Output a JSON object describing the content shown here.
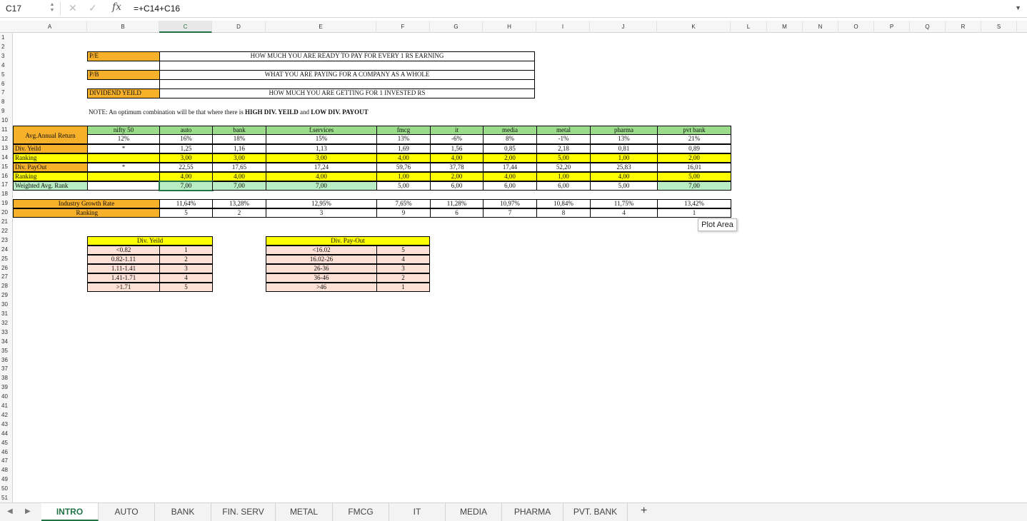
{
  "formula_bar": {
    "cell_ref": "C17",
    "formula": "=+C14+C16"
  },
  "columns": [
    "A",
    "B",
    "C",
    "D",
    "E",
    "F",
    "G",
    "H",
    "I",
    "J",
    "K",
    "L",
    "M",
    "N",
    "O",
    "P",
    "Q",
    "R",
    "S"
  ],
  "rows": [
    "1",
    "2",
    "3",
    "4",
    "5",
    "6",
    "7",
    "8",
    "9",
    "10",
    "11",
    "12",
    "13",
    "14",
    "15",
    "16",
    "17",
    "18",
    "19",
    "20",
    "21",
    "22",
    "23",
    "24",
    "25",
    "26",
    "27",
    "28",
    "29",
    "30",
    "31",
    "32",
    "33",
    "34",
    "35",
    "36",
    "37",
    "38",
    "39",
    "40",
    "41",
    "42",
    "43",
    "44",
    "45",
    "46",
    "47",
    "48",
    "49",
    "50",
    "51"
  ],
  "definitions": [
    {
      "term": "P/E",
      "meaning": "HOW MUCH YOU ARE READY TO PAY FOR EVERY 1 RS EARNING"
    },
    {
      "term": "P/B",
      "meaning": "WHAT YOU ARE PAYING FOR A COMPANY AS A WHOLE"
    },
    {
      "term": "DIVIDEND YEILD",
      "meaning": "HOW MUCH YOU ARE GETTING FOR 1 INVESTED RS"
    }
  ],
  "note": {
    "prefix": "NOTE: An optimum combination will be that where there is ",
    "bold1": "HIGH DIV. YEILD",
    "mid": " and ",
    "bold2": "LOW DIV. PAYOUT"
  },
  "main_table": {
    "sectors": [
      "nifty 50",
      "auto",
      "bank",
      "f.services",
      "fmcg",
      "it",
      "media",
      "metal",
      "pharma",
      "pvt bank"
    ],
    "rows": [
      {
        "label": "Avg.Annual Return",
        "values": [
          "12%",
          "16%",
          "18%",
          "15%",
          "13%",
          "-6%",
          "8%",
          "-1%",
          "13%",
          "21%"
        ]
      },
      {
        "label": "Div. Yeild",
        "values": [
          "*",
          "1,25",
          "1,16",
          "1,13",
          "1,69",
          "1,56",
          "0,85",
          "2,18",
          "0,81",
          "0,89"
        ]
      },
      {
        "label": "Ranking",
        "values": [
          "",
          "3,00",
          "3,00",
          "3,00",
          "4,00",
          "4,00",
          "2,00",
          "5,00",
          "1,00",
          "2,00"
        ]
      },
      {
        "label": "Div. PayOut",
        "values": [
          "*",
          "22,55",
          "17,65",
          "17,24",
          "59,76",
          "37,78",
          "17,44",
          "52,20",
          "25,83",
          "16,01"
        ]
      },
      {
        "label": "Ranking",
        "values": [
          "",
          "4,00",
          "4,00",
          "4,00",
          "1,00",
          "2,00",
          "4,00",
          "1,00",
          "4,00",
          "5,00"
        ]
      },
      {
        "label": "Weighted Avg. Rank",
        "values": [
          "",
          "7,00",
          "7,00",
          "7,00",
          "5,00",
          "6,00",
          "6,00",
          "6,00",
          "5,00",
          "7,00"
        ]
      }
    ]
  },
  "growth_table": {
    "row1_label": "Industry Growth Rate",
    "row2_label": "Ranking",
    "growth": [
      "11,64%",
      "13,28%",
      "12,95%",
      "7,65%",
      "11,28%",
      "10,97%",
      "10,84%",
      "11,75%",
      "13,42%"
    ],
    "ranking": [
      "5",
      "2",
      "3",
      "9",
      "6",
      "7",
      "8",
      "4",
      "1"
    ]
  },
  "yield_table": {
    "title": "Div. Yeild",
    "rows": [
      [
        "<0.82",
        "1"
      ],
      [
        "0.82-1.11",
        "2"
      ],
      [
        "1.11-1.41",
        "3"
      ],
      [
        "1.41-1.71",
        "4"
      ],
      [
        ">1.71",
        "5"
      ]
    ]
  },
  "payout_table": {
    "title": "Div. Pay-Out",
    "rows": [
      [
        "<16.02",
        "5"
      ],
      [
        "16.02-26",
        "4"
      ],
      [
        "26-36",
        "3"
      ],
      [
        "36-46",
        "2"
      ],
      [
        ">46",
        "1"
      ]
    ]
  },
  "tooltip": "Plot Area",
  "sheet_tabs": [
    "INTRO",
    "AUTO",
    "BANK",
    "FIN. SERV",
    "METAL",
    "FMCG",
    "IT",
    "MEDIA",
    "PHARMA",
    "PVT. BANK"
  ],
  "active_tab": "INTRO",
  "colors": {
    "orange": "#f7b02a",
    "green": "#9bdc8b",
    "yellow": "#ffff00",
    "light_green": "#b8ecc3",
    "pink": "#fde0d6",
    "accent": "#217346"
  }
}
